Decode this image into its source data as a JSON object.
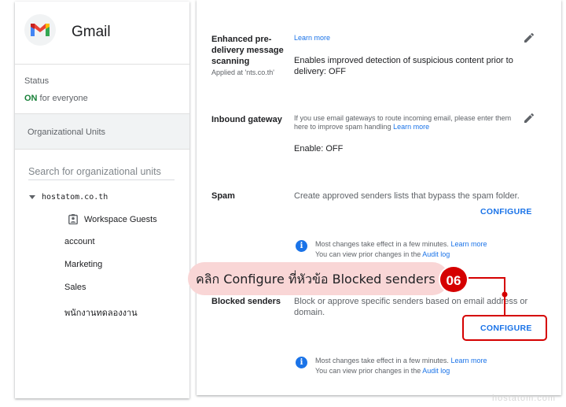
{
  "left_panel": {
    "app_name": "Gmail",
    "status_title": "Status",
    "status_on": "ON",
    "status_rest": " for everyone",
    "ou_header": "Organizational Units",
    "search_placeholder": "Search for organizational units",
    "tree": {
      "root": "hostatom.co.th",
      "items": [
        "Workspace Guests",
        "account",
        "Marketing",
        "Sales",
        "พนักงานทดลองงาน"
      ]
    }
  },
  "settings": {
    "enhanced": {
      "label": "Enhanced pre-delivery message scanning",
      "label_line1": "Enhanced pre-",
      "label_line2": "delivery message",
      "label_line3": "scanning",
      "applied": "Applied at 'nts.co.th'",
      "learn_more": "Learn more",
      "desc_line1": "Enables improved detection of suspicious content prior to",
      "desc_line2": "delivery: OFF"
    },
    "inbound": {
      "label": "Inbound gateway",
      "text_line1": "If you use email gateways to route incoming email, please enter them",
      "text_line2": "here to improve spam handling",
      "learn_more": "Learn more",
      "status": "Enable: OFF"
    },
    "spam": {
      "label": "Spam",
      "desc": "Create approved senders lists that bypass the spam folder.",
      "configure": "CONFIGURE",
      "info_line1": "Most changes take effect in a few minutes.",
      "info_learn": "Learn more",
      "info_line2": "You can view prior changes in the",
      "audit": "Audit log"
    },
    "blocked": {
      "label": "Blocked senders",
      "desc_line1": "Block or approve specific senders based on email address or",
      "desc_line2": "domain.",
      "configure": "CONFIGURE",
      "info_line1": "Most changes take effect in a few minutes.",
      "info_learn": "Learn more",
      "info_line2": "You can view prior changes in the",
      "audit": "Audit log"
    }
  },
  "annotation": {
    "text": "คลิก Configure ที่หัวข้อ Blocked senders",
    "step": "06",
    "color": "#d50000"
  },
  "watermark": "hostatom.com",
  "colors": {
    "link": "#1a73e8",
    "on": "#188038",
    "callout": "#f9d6d6"
  }
}
